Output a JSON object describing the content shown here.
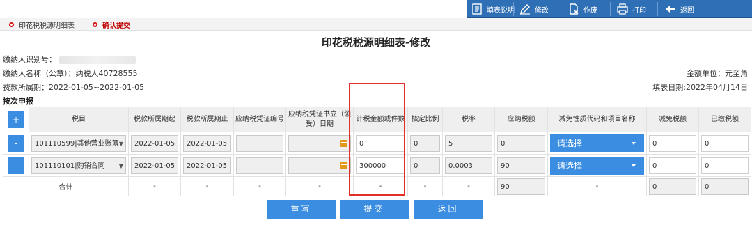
{
  "toolbar": {
    "items": [
      {
        "label": "填表说明",
        "icon": "document-icon"
      },
      {
        "label": "修改",
        "icon": "pencil-icon"
      },
      {
        "label": "作废",
        "icon": "void-document-icon"
      },
      {
        "label": "打印",
        "icon": "printer-icon"
      },
      {
        "label": "返回",
        "icon": "back-arrow-icon"
      }
    ]
  },
  "tabs": [
    {
      "label": "印花税税源明细表",
      "active": false
    },
    {
      "label": "确认提交",
      "active": true
    }
  ],
  "page": {
    "title": "印花税税源明细表-修改"
  },
  "info": {
    "taxpayer_id_label": "缴纳人识别号：",
    "taxpayer_name_label": "缴纳人名称（公章）：",
    "taxpayer_name_value": "纳税人40728555",
    "period_label": "费款所属期：",
    "period_value": "2022-01-05~2022-01-05",
    "unit_text": "金额单位：元至角",
    "fill_date_text": "填表日期:2022年04月14日",
    "section_label": "按次申报"
  },
  "table": {
    "add_button": "+",
    "remove_button": "-",
    "headers": [
      "税目",
      "税款所属期起",
      "税款所属期止",
      "应纳税凭证编号",
      "应纳税凭证书立（领受）日期",
      "计税金额或件数",
      "核定比例",
      "税率",
      "应纳税额",
      "减免性质代码和项目名称",
      "减免税额",
      "已缴税额"
    ],
    "rows": [
      {
        "item": "101110599|其他营业账簿",
        "start": "2022-01-05",
        "end": "2022-01-05",
        "voucher_no": "",
        "issue_date": "",
        "amount": "0",
        "ratio": "0",
        "rate": "5",
        "tax": "0",
        "relief_select": "请选择",
        "relief_amount": "0",
        "paid": "0"
      },
      {
        "item": "101110101|购销合同",
        "start": "2022-01-05",
        "end": "2022-01-05",
        "voucher_no": "",
        "issue_date": "",
        "amount": "300000",
        "ratio": "0",
        "rate": "0.0003",
        "tax": "90",
        "relief_select": "请选择",
        "relief_amount": "0",
        "paid": "0"
      }
    ],
    "total": {
      "label": "合计",
      "dash": "-",
      "tax": "90",
      "relief_amount": "0",
      "paid": "0"
    }
  },
  "actions": [
    "重写",
    "提交",
    "返回"
  ],
  "colors": {
    "toolbar": "#2f6fb5",
    "button": "#3a8de0",
    "highlight": "#e0302a",
    "active_tab": "#c00000",
    "calendar": "#e39a1a"
  }
}
